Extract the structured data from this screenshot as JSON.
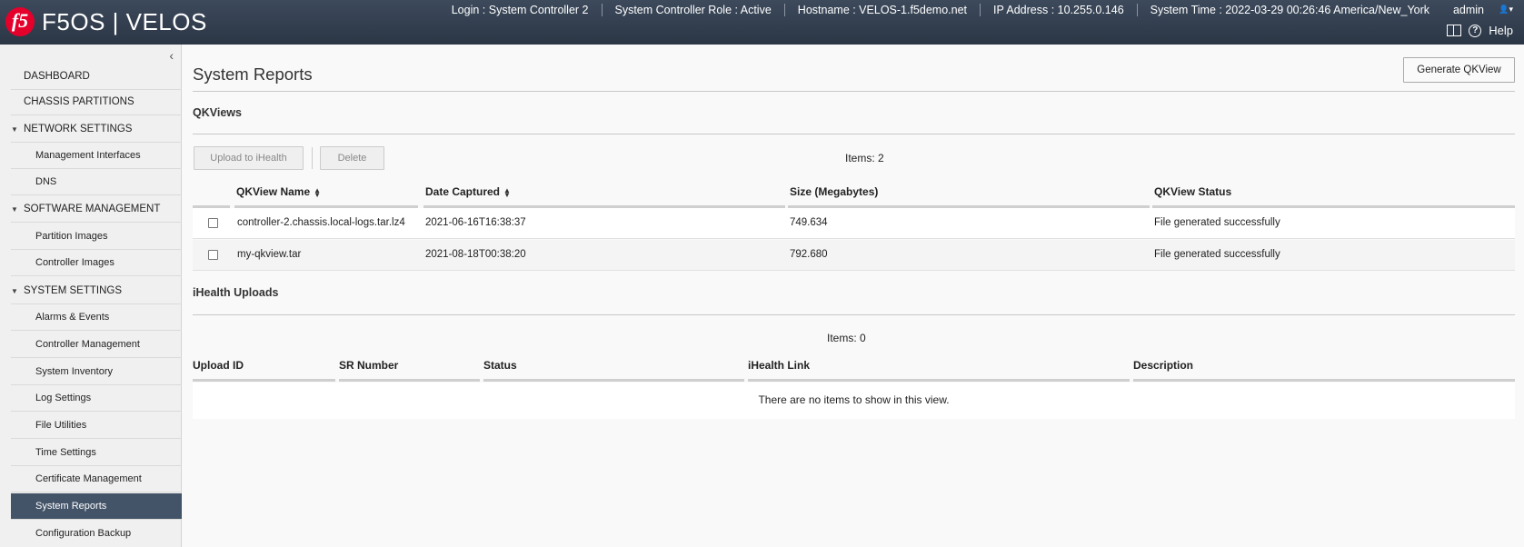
{
  "header": {
    "logo_text": "f5",
    "product": "F5OS | VELOS",
    "info": [
      "Login : System Controller 2",
      "System Controller Role : Active",
      "Hostname : VELOS-1.f5demo.net",
      "IP Address : 10.255.0.146",
      "System Time : 2022-03-29 00:26:46 America/New_York"
    ],
    "user": "admin",
    "help": "Help"
  },
  "sidebar": {
    "items": [
      {
        "label": "DASHBOARD",
        "kind": "top"
      },
      {
        "label": "CHASSIS PARTITIONS",
        "kind": "top"
      },
      {
        "label": "NETWORK SETTINGS",
        "kind": "section"
      },
      {
        "label": "Management Interfaces",
        "kind": "sub"
      },
      {
        "label": "DNS",
        "kind": "sub"
      },
      {
        "label": "SOFTWARE MANAGEMENT",
        "kind": "section"
      },
      {
        "label": "Partition Images",
        "kind": "sub"
      },
      {
        "label": "Controller Images",
        "kind": "sub"
      },
      {
        "label": "SYSTEM SETTINGS",
        "kind": "section"
      },
      {
        "label": "Alarms & Events",
        "kind": "sub"
      },
      {
        "label": "Controller Management",
        "kind": "sub"
      },
      {
        "label": "System Inventory",
        "kind": "sub"
      },
      {
        "label": "Log Settings",
        "kind": "sub"
      },
      {
        "label": "File Utilities",
        "kind": "sub"
      },
      {
        "label": "Time Settings",
        "kind": "sub"
      },
      {
        "label": "Certificate Management",
        "kind": "sub"
      },
      {
        "label": "System Reports",
        "kind": "sub",
        "active": true
      },
      {
        "label": "Configuration Backup",
        "kind": "sub"
      }
    ]
  },
  "main": {
    "title": "System Reports",
    "generate_button": "Generate QKView",
    "qkviews": {
      "title": "QKViews",
      "upload_button": "Upload to iHealth",
      "delete_button": "Delete",
      "items_count": "Items: 2",
      "columns": [
        "QKView Name",
        "Date Captured",
        "Size (Megabytes)",
        "QKView Status"
      ],
      "rows": [
        {
          "name": "controller-2.chassis.local-logs.tar.lz4",
          "date": "2021-06-16T16:38:37",
          "size": "749.634",
          "status": "File generated successfully"
        },
        {
          "name": "my-qkview.tar",
          "date": "2021-08-18T00:38:20",
          "size": "792.680",
          "status": "File generated successfully"
        }
      ]
    },
    "ihealth": {
      "title": "iHealth Uploads",
      "items_count": "Items: 0",
      "columns": [
        "Upload ID",
        "SR Number",
        "Status",
        "iHealth Link",
        "Description"
      ],
      "empty_message": "There are no items to show in this view."
    }
  }
}
